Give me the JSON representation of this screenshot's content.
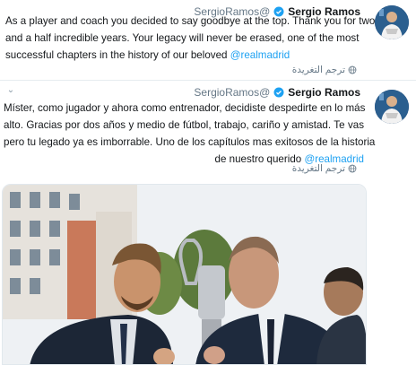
{
  "tweets": [
    {
      "name": "Sergio Ramos",
      "handle": "SergioRamos@",
      "lines": [
        "As a player and coach you decided to say goodbye at the top. Thank you for two",
        "and a half incredible years. Your legacy will never be erased, one of the most",
        "successful chapters in the history of our beloved"
      ],
      "mention": "@realmadrid",
      "translate_label": "ترجم التغريدة"
    },
    {
      "name": "Sergio Ramos",
      "handle": "SergioRamos@",
      "lines": [
        "Míster, como jugador y ahora como entrenador, decidiste despedirte en lo más",
        "alto. Gracias por dos años y medio de fútbol, trabajo, cariño y amistad. Te vas",
        "pero tu legado ya es imborrable. Uno de los capítulos mas exitosos de la historia",
        "de nuestro querido"
      ],
      "mention": "@realmadrid",
      "translate_label": "ترجم التغريدة",
      "media_alt": "photo"
    }
  ],
  "icons": {
    "verified": "verified-badge-icon",
    "chevron": "chevron-down-icon",
    "globe": "globe-icon"
  },
  "colors": {
    "accent": "#1da1f2",
    "muted": "#657786",
    "text": "#14171a"
  }
}
